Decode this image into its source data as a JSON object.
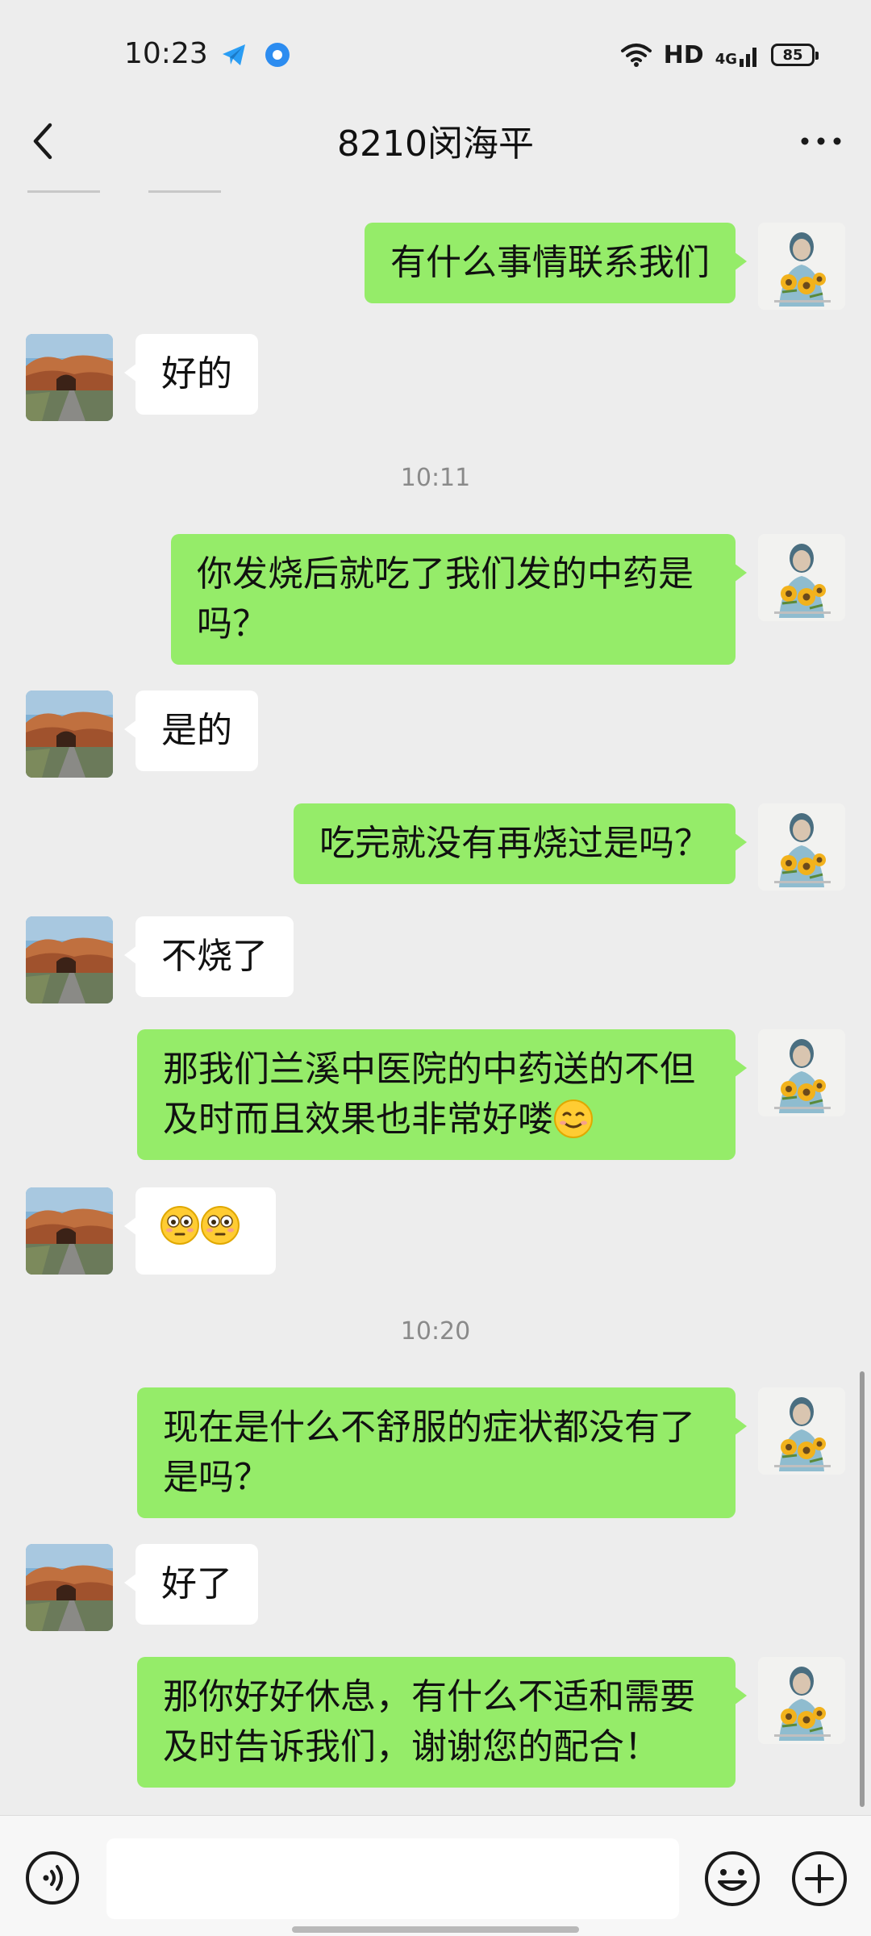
{
  "status_bar": {
    "time": "10:23",
    "hd": "HD",
    "network": "4G",
    "battery": "85"
  },
  "header": {
    "title": "8210闵海平"
  },
  "timestamps": [
    "10:11",
    "10:20"
  ],
  "messages": [
    {
      "side": "out",
      "text": "有什么事情联系我们"
    },
    {
      "side": "in",
      "text": "好的"
    },
    {
      "side": "out",
      "line1": "你发烧后就吃了我们发的中药是",
      "line2": "吗？"
    },
    {
      "side": "in",
      "text": "是的"
    },
    {
      "side": "out",
      "text": "吃完就没有再烧过是吗？"
    },
    {
      "side": "in",
      "text": "不烧了"
    },
    {
      "side": "out",
      "line1": "那我们兰溪中医院的中药送的不但",
      "line2": "及时而且效果也非常好喽",
      "emoji": "smiling-face"
    },
    {
      "side": "in",
      "emoji": "flushed-face-x2"
    },
    {
      "side": "out",
      "line1": "现在是什么不舒服的症状都没有了",
      "line2": "是吗？"
    },
    {
      "side": "in",
      "text": "好了"
    },
    {
      "side": "out",
      "line1": "那你好好休息，有什么不适和需要",
      "line2": "及时告诉我们，谢谢您的配合！"
    }
  ],
  "input_bar": {
    "voice_icon": "voice-icon",
    "emoji_icon": "emoji-icon",
    "plus_icon": "plus-icon"
  },
  "colors": {
    "background": "#ededed",
    "outgoing_bubble": "#95ec69",
    "incoming_bubble": "#ffffff"
  }
}
